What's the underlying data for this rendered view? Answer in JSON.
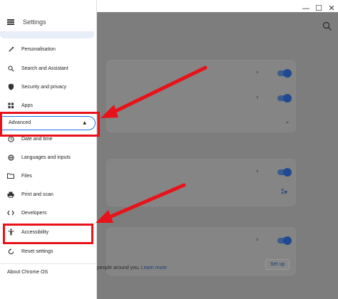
{
  "window": {
    "minimize": "—",
    "maximize": "☐",
    "close": "✕"
  },
  "sidebar": {
    "title": "Settings",
    "items": [
      {
        "label": "Personalisation",
        "icon": "brush-icon"
      },
      {
        "label": "Search and Assistant",
        "icon": "search-icon"
      },
      {
        "label": "Security and privacy",
        "icon": "shield-icon"
      },
      {
        "label": "Apps",
        "icon": "apps-grid-icon"
      },
      {
        "label": "Advanced",
        "icon": "caret-up-icon"
      },
      {
        "label": "Date and time",
        "icon": "clock-icon"
      },
      {
        "label": "Languages and inputs",
        "icon": "globe-icon"
      },
      {
        "label": "Files",
        "icon": "folder-icon"
      },
      {
        "label": "Print and scan",
        "icon": "printer-icon"
      },
      {
        "label": "Developers",
        "icon": "code-icon"
      },
      {
        "label": "Accessibility",
        "icon": "accessibility-icon"
      },
      {
        "label": "Reset settings",
        "icon": "reset-icon"
      }
    ],
    "about": "About Chrome OS"
  },
  "content": {
    "partial_text": "people around you.",
    "learn_more": "Learn more",
    "setup_button": "Set up"
  },
  "colors": {
    "highlight": "#e8121b",
    "accent": "#1a73e8",
    "overlay": "#7d7d7d"
  }
}
